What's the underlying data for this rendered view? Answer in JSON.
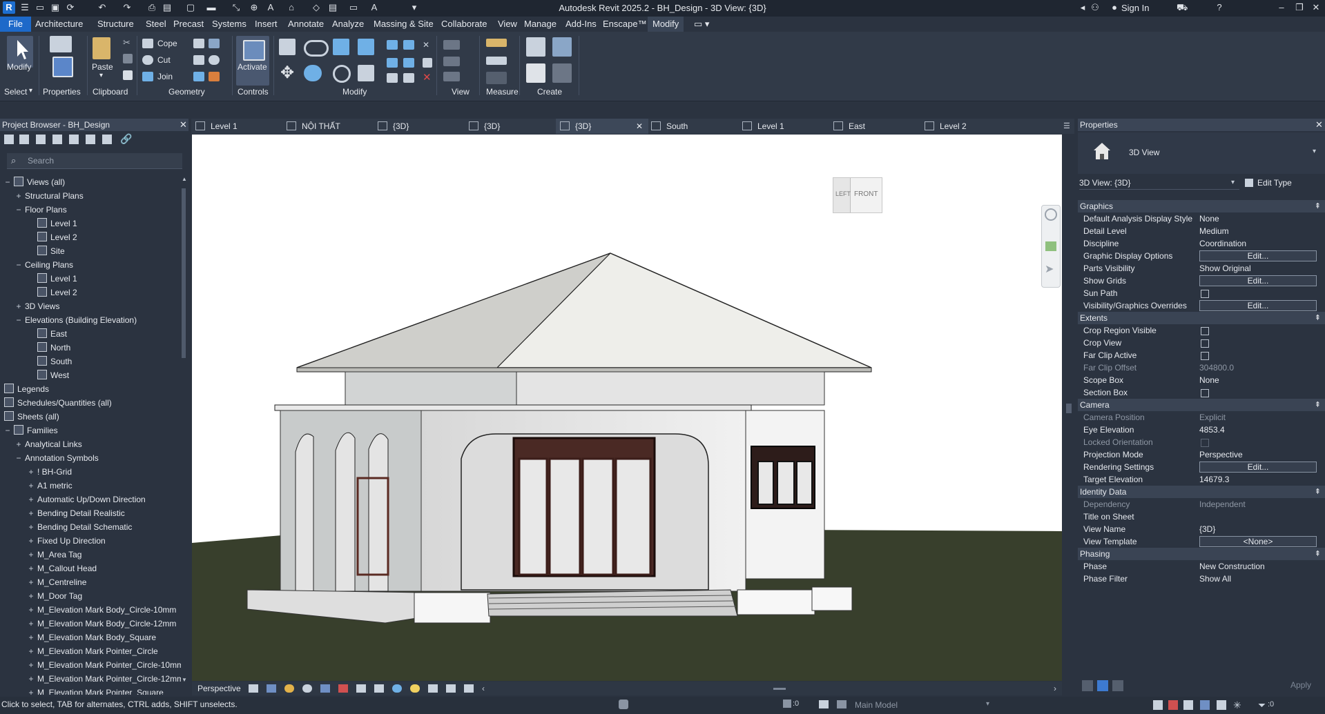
{
  "window": {
    "title": "Autodesk Revit 2025.2 - BH_Design - 3D View: {3D}"
  },
  "titlebar_right": {
    "sign_in": "Sign In"
  },
  "menu": {
    "items": [
      "File",
      "Architecture",
      "Structure",
      "Steel",
      "Precast",
      "Systems",
      "Insert",
      "Annotate",
      "Analyze",
      "Massing & Site",
      "Collaborate",
      "View",
      "Manage",
      "Add-Ins",
      "Enscape™",
      "Modify"
    ],
    "active": "Modify"
  },
  "ribbon": {
    "select": {
      "modify": "Modify",
      "select_label": "Select"
    },
    "properties": {
      "label": "Properties"
    },
    "clipboard": {
      "paste": "Paste",
      "label": "Clipboard"
    },
    "geometry": {
      "cope": "Cope",
      "cut": "Cut",
      "join": "Join",
      "label": "Geometry"
    },
    "controls": {
      "activate": "Activate",
      "label": "Controls"
    },
    "modify": {
      "label": "Modify"
    },
    "view": {
      "label": "View"
    },
    "measure": {
      "label": "Measure"
    },
    "create": {
      "label": "Create"
    }
  },
  "project_browser": {
    "title": "Project Browser - BH_Design",
    "search_placeholder": "Search",
    "items": [
      {
        "label": "Views (all)",
        "level": 0,
        "toggle": "−",
        "icon": "views"
      },
      {
        "label": "Structural Plans",
        "level": 1,
        "toggle": "+"
      },
      {
        "label": "Floor Plans",
        "level": 1,
        "toggle": "−"
      },
      {
        "label": "Level 1",
        "level": 2,
        "icon": "view"
      },
      {
        "label": "Level 2",
        "level": 2,
        "icon": "view"
      },
      {
        "label": "Site",
        "level": 2,
        "icon": "view"
      },
      {
        "label": "Ceiling Plans",
        "level": 1,
        "toggle": "−"
      },
      {
        "label": "Level 1",
        "level": 2,
        "icon": "view"
      },
      {
        "label": "Level 2",
        "level": 2,
        "icon": "view"
      },
      {
        "label": "3D Views",
        "level": 1,
        "toggle": "+"
      },
      {
        "label": "Elevations (Building Elevation)",
        "level": 1,
        "toggle": "−"
      },
      {
        "label": "East",
        "level": 2,
        "icon": "view"
      },
      {
        "label": "North",
        "level": 2,
        "icon": "view"
      },
      {
        "label": "South",
        "level": 2,
        "icon": "view"
      },
      {
        "label": "West",
        "level": 2,
        "icon": "view"
      },
      {
        "label": "Legends",
        "level": 0,
        "icon": "legend"
      },
      {
        "label": "Schedules/Quantities (all)",
        "level": 0,
        "icon": "schedule"
      },
      {
        "label": "Sheets (all)",
        "level": 0,
        "icon": "sheet"
      },
      {
        "label": "Families",
        "level": 0,
        "toggle": "−",
        "icon": "family"
      },
      {
        "label": "Analytical Links",
        "level": 1,
        "toggle": "+"
      },
      {
        "label": "Annotation Symbols",
        "level": 1,
        "toggle": "−"
      },
      {
        "label": "! BH-Grid",
        "level": 2,
        "toggle": "+"
      },
      {
        "label": "A1 metric",
        "level": 2,
        "toggle": "+"
      },
      {
        "label": "Automatic Up/Down Direction",
        "level": 2,
        "toggle": "+"
      },
      {
        "label": "Bending Detail Realistic",
        "level": 2,
        "toggle": "+"
      },
      {
        "label": "Bending Detail Schematic",
        "level": 2,
        "toggle": "+"
      },
      {
        "label": "Fixed Up Direction",
        "level": 2,
        "toggle": "+"
      },
      {
        "label": "M_Area Tag",
        "level": 2,
        "toggle": "+"
      },
      {
        "label": "M_Callout Head",
        "level": 2,
        "toggle": "+"
      },
      {
        "label": "M_Centreline",
        "level": 2,
        "toggle": "+"
      },
      {
        "label": "M_Door Tag",
        "level": 2,
        "toggle": "+"
      },
      {
        "label": "M_Elevation Mark Body_Circle-10mm",
        "level": 2,
        "toggle": "+"
      },
      {
        "label": "M_Elevation Mark Body_Circle-12mm",
        "level": 2,
        "toggle": "+"
      },
      {
        "label": "M_Elevation Mark Body_Square",
        "level": 2,
        "toggle": "+"
      },
      {
        "label": "M_Elevation Mark Pointer_Circle",
        "level": 2,
        "toggle": "+"
      },
      {
        "label": "M_Elevation Mark Pointer_Circle-10mm",
        "level": 2,
        "toggle": "+"
      },
      {
        "label": "M_Elevation Mark Pointer_Circle-12mm",
        "level": 2,
        "toggle": "+"
      },
      {
        "label": "M_Elevation Mark Pointer_Square",
        "level": 2,
        "toggle": "+"
      }
    ]
  },
  "view_tabs": [
    {
      "label": "Level 1",
      "icon": "plan"
    },
    {
      "label": "NỘI THẤT",
      "icon": "plan"
    },
    {
      "label": "{3D}",
      "icon": "house"
    },
    {
      "label": "{3D}",
      "icon": "house"
    },
    {
      "label": "{3D}",
      "icon": "house",
      "active": true
    },
    {
      "label": "South",
      "icon": "elev"
    },
    {
      "label": "Level 1",
      "icon": "plan"
    },
    {
      "label": "East",
      "icon": "elev"
    },
    {
      "label": "Level 2",
      "icon": "plan"
    }
  ],
  "viewcube": {
    "left": "LEFT",
    "front": "FRONT"
  },
  "view_control": {
    "projection": "Perspective"
  },
  "properties": {
    "title": "Properties",
    "type_name": "3D View",
    "selector": "3D View: {3D}",
    "edit_type": "Edit Type",
    "apply": "Apply",
    "sections": [
      {
        "name": "Graphics",
        "rows": [
          {
            "name": "Default Analysis Display Style",
            "value": "None"
          },
          {
            "name": "Detail Level",
            "value": "Medium"
          },
          {
            "name": "Discipline",
            "value": "Coordination"
          },
          {
            "name": "Graphic Display Options",
            "button": "Edit..."
          },
          {
            "name": "Parts Visibility",
            "value": "Show Original"
          },
          {
            "name": "Show Grids",
            "button": "Edit..."
          },
          {
            "name": "Sun Path",
            "checkbox": false
          },
          {
            "name": "Visibility/Graphics Overrides",
            "button": "Edit..."
          }
        ]
      },
      {
        "name": "Extents",
        "rows": [
          {
            "name": "Crop Region Visible",
            "checkbox": false
          },
          {
            "name": "Crop View",
            "checkbox": false
          },
          {
            "name": "Far Clip Active",
            "checkbox": false
          },
          {
            "name": "Far Clip Offset",
            "value": "304800.0",
            "disabled": true
          },
          {
            "name": "Scope Box",
            "value": "None"
          },
          {
            "name": "Section Box",
            "checkbox": false
          }
        ]
      },
      {
        "name": "Camera",
        "rows": [
          {
            "name": "Camera Position",
            "value": "Explicit",
            "disabled": true
          },
          {
            "name": "Eye Elevation",
            "value": "4853.4"
          },
          {
            "name": "Locked Orientation",
            "checkbox": false,
            "disabled": true
          },
          {
            "name": "Projection Mode",
            "value": "Perspective"
          },
          {
            "name": "Rendering Settings",
            "button": "Edit..."
          },
          {
            "name": "Target Elevation",
            "value": "14679.3"
          }
        ]
      },
      {
        "name": "Identity Data",
        "rows": [
          {
            "name": "Dependency",
            "value": "Independent",
            "disabled": true
          },
          {
            "name": "Title on Sheet",
            "value": ""
          },
          {
            "name": "View Name",
            "value": "{3D}"
          },
          {
            "name": "View Template",
            "button": "<None>"
          }
        ]
      },
      {
        "name": "Phasing",
        "rows": [
          {
            "name": "Phase",
            "value": "New Construction"
          },
          {
            "name": "Phase Filter",
            "value": "Show All"
          }
        ]
      }
    ]
  },
  "statusbar": {
    "message": "Click to select, TAB for alternates, CTRL adds, SHIFT unselects.",
    "workset_count": ":0",
    "model": "Main Model",
    "filter_count": ":0"
  },
  "colors": {
    "accent": "#1d69c9",
    "bg": "#2b3340",
    "ground": "#3a412d",
    "sky": "#ffffff"
  }
}
